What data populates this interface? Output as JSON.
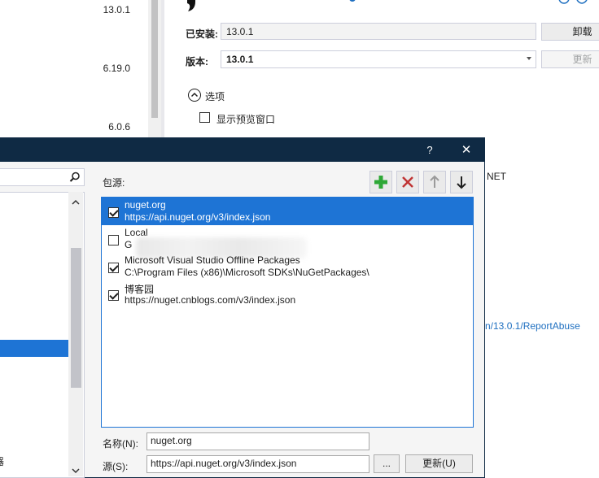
{
  "package_list": {
    "versions": [
      "13.0.1",
      "6.19.0",
      "6.0.6"
    ]
  },
  "details": {
    "installed_label": "已安装:",
    "installed_value": "13.0.1",
    "uninstall_button": "卸载",
    "version_label": "版本:",
    "version_value": "13.0.1",
    "update_button": "更新",
    "options_label": "选项",
    "show_preview_label": "显示预览窗口",
    "framework_fragment": "NET",
    "report_abuse_link": "n/13.0.1/ReportAbuse"
  },
  "dialog": {
    "help_button": "?",
    "close_button": "✕",
    "sources_label": "包源:",
    "sources": [
      {
        "name": "nuget.org",
        "url": "https://api.nuget.org/v3/index.json",
        "checked": true,
        "selected": true
      },
      {
        "name": "Local",
        "url": "G",
        "checked": false,
        "selected": false
      },
      {
        "name": "Microsoft Visual Studio Offline Packages",
        "url": "C:\\Program Files (x86)\\Microsoft SDKs\\NuGetPackages\\",
        "checked": true,
        "selected": false
      },
      {
        "name": "博客园",
        "url": "https://nuget.cnblogs.com/v3/index.json",
        "checked": true,
        "selected": false
      }
    ],
    "name_label": "名称(N):",
    "name_value": "nuget.org",
    "source_label": "源(S):",
    "source_value": "https://api.nuget.org/v3/index.json",
    "browse_button": "...",
    "update_button": "更新(U)",
    "left_tree_fragment": "器"
  },
  "colors": {
    "titlebar": "#0f2a44",
    "selection": "#1e74d5",
    "add_icon": "#2ea836",
    "remove_icon": "#c03434",
    "link": "#1e6fc0"
  }
}
